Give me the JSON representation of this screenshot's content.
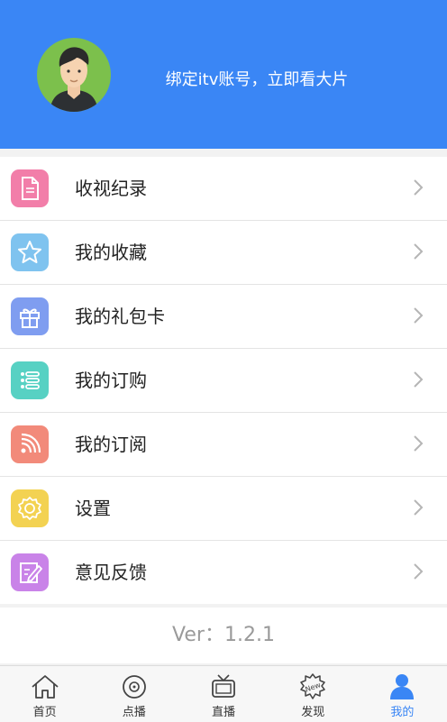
{
  "header": {
    "bind_prompt": "绑定itv账号，立即看大片",
    "accent_color": "#3a86f5"
  },
  "menu": {
    "items": [
      {
        "label": "收视纪录",
        "icon": "document-icon",
        "color": "#f27ea9"
      },
      {
        "label": "我的收藏",
        "icon": "star-icon",
        "color": "#7fc3ef"
      },
      {
        "label": "我的礼包卡",
        "icon": "gift-icon",
        "color": "#7f9df0"
      },
      {
        "label": "我的订购",
        "icon": "list-icon",
        "color": "#57d1c3"
      },
      {
        "label": "我的订阅",
        "icon": "rss-icon",
        "color": "#f28a7a"
      },
      {
        "label": "设置",
        "icon": "gear-icon",
        "color": "#f3d252"
      },
      {
        "label": "意见反馈",
        "icon": "feedback-icon",
        "color": "#c983e8"
      }
    ]
  },
  "version": {
    "label": "Ver：1.2.1"
  },
  "tabbar": {
    "active_color": "#3a86f5",
    "tabs": [
      {
        "label": "首页",
        "icon": "home-icon"
      },
      {
        "label": "点播",
        "icon": "disc-icon"
      },
      {
        "label": "直播",
        "icon": "tv-icon"
      },
      {
        "label": "发现",
        "icon": "new-badge-icon"
      },
      {
        "label": "我的",
        "icon": "person-icon"
      }
    ]
  }
}
